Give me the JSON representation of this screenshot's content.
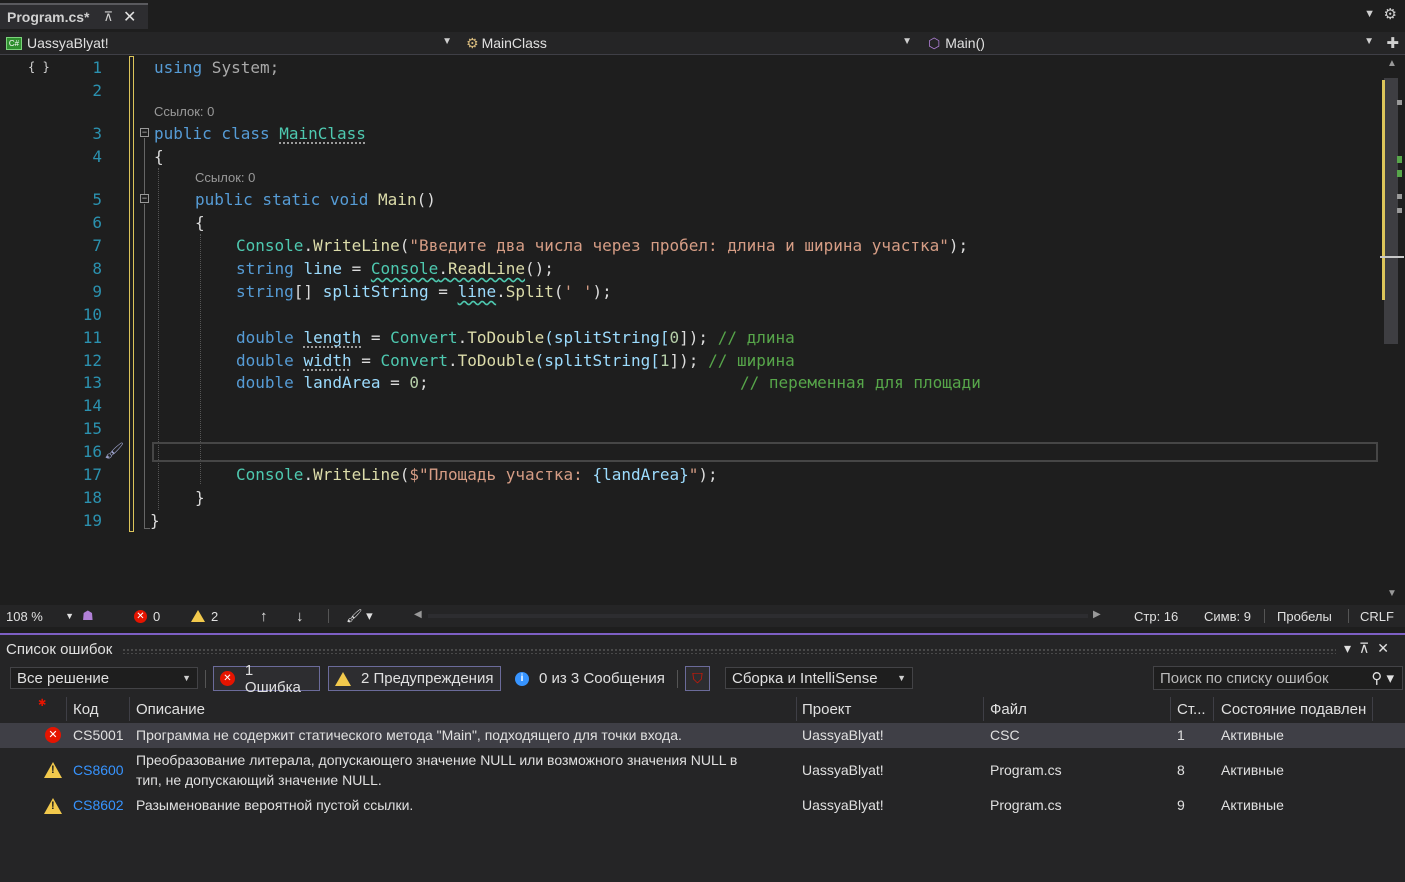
{
  "tab": {
    "title": "Program.cs*",
    "pin_glyph": "⊼",
    "close_glyph": "✕"
  },
  "navbar": {
    "project": "UassyaBlyat!",
    "class": "MainClass",
    "member": "Main()"
  },
  "editor": {
    "line_numbers": [
      "1",
      "2",
      "3",
      "4",
      "5",
      "6",
      "7",
      "8",
      "9",
      "10",
      "11",
      "12",
      "13",
      "14",
      "15",
      "16",
      "17",
      "18",
      "19"
    ],
    "codelens": [
      "Ссылок: 0",
      "Ссылок: 0"
    ],
    "code": {
      "l1_using": "using",
      "l1_system": " System;",
      "l3_public": "public",
      "l3_class": " class ",
      "l3_name": "MainClass",
      "l4": "{",
      "l5_pub": "public",
      "l5_static": " static",
      "l5_void": " void",
      "l5_main": " Main",
      "l5_paren": "()",
      "l6": "{",
      "l7_console": "Console",
      "l7_dot": ".",
      "l7_wl": "WriteLine",
      "l7_open": "(",
      "l7_str": "\"Введите два числа через пробел: длина и ширина участка\"",
      "l7_close": ");",
      "l8_type": "string",
      "l8_var": "line",
      "l8_eq": " = ",
      "l8_console": "Console",
      "l8_dot": ".",
      "l8_rl": "ReadLine",
      "l8_end": "();",
      "l9_type": "string",
      "l9_arr": "[] ",
      "l9_var": "splitString",
      "l9_eq": " = ",
      "l9_line": "line",
      "l9_dot": ".",
      "l9_split": "Split",
      "l9_open": "(",
      "l9_ch": "' '",
      "l9_end": ");",
      "l11_type": "double",
      "l11_var": "length",
      "l11_eq": " = ",
      "l11_conv": "Convert",
      "l11_dot": ".",
      "l11_td": "ToDouble",
      "l11_arg": "(splitString[",
      "l11_idx": "0",
      "l11_end": "]); ",
      "l11_cm": "// длина",
      "l12_type": "double",
      "l12_var": "width",
      "l12_eq": " = ",
      "l12_conv": "Convert",
      "l12_dot": ".",
      "l12_td": "ToDouble",
      "l12_arg": "(splitString[",
      "l12_idx": "1",
      "l12_end": "]); ",
      "l12_cm": "// ширина",
      "l13_type": "double",
      "l13_var": "landArea",
      "l13_eq": " = ",
      "l13_val": "0",
      "l13_semi": ";",
      "l13_cm": "// переменная для площади",
      "l17_console": "Console",
      "l17_dot": ".",
      "l17_wl": "WriteLine",
      "l17_open": "(",
      "l17_str1": "$\"Площадь участка: ",
      "l17_interp": "{landArea}",
      "l17_str2": "\"",
      "l17_end": ");",
      "l18": "}",
      "l19": "}"
    }
  },
  "editor_status": {
    "zoom": "108 %",
    "errors": "0",
    "warnings": "2",
    "line": "Стр: 16",
    "col": "Симв: 9",
    "whitespace": "Пробелы",
    "eol": "CRLF"
  },
  "error_list": {
    "title": "Список ошибок",
    "scope": "Все решение",
    "errors_btn": "1 Ошибка",
    "warnings_btn": "2 Предупреждения",
    "messages_btn": "0 из 3 Сообщения",
    "build_filter": "Сборка и IntelliSense",
    "search_placeholder": "Поиск по списку ошибок",
    "columns": [
      "Код",
      "Описание",
      "Проект",
      "Файл",
      "Ст...",
      "Состояние подавлен"
    ],
    "rows": [
      {
        "severity": "error",
        "code": "CS5001",
        "desc1": "Программа не содержит статического метода \"Main\", подходящего для точки входа.",
        "desc2": "",
        "project": "UassyaBlyat!",
        "file": "CSC",
        "line": "1",
        "state": "Активные"
      },
      {
        "severity": "warning",
        "code": "CS8600",
        "desc1": "Преобразование литерала, допускающего значение NULL или возможного значения NULL в",
        "desc2": "тип, не допускающий значение NULL.",
        "project": "UassyaBlyat!",
        "file": "Program.cs",
        "line": "8",
        "state": "Активные"
      },
      {
        "severity": "warning",
        "code": "CS8602",
        "desc1": "Разыменование вероятной пустой ссылки.",
        "desc2": "",
        "project": "UassyaBlyat!",
        "file": "Program.cs",
        "line": "9",
        "state": "Активные"
      }
    ]
  },
  "colors": {
    "accent": "#7d5fc4",
    "error": "#e51400",
    "warning": "#f2c94c",
    "info": "#3794ff",
    "link": "#3794ff"
  }
}
